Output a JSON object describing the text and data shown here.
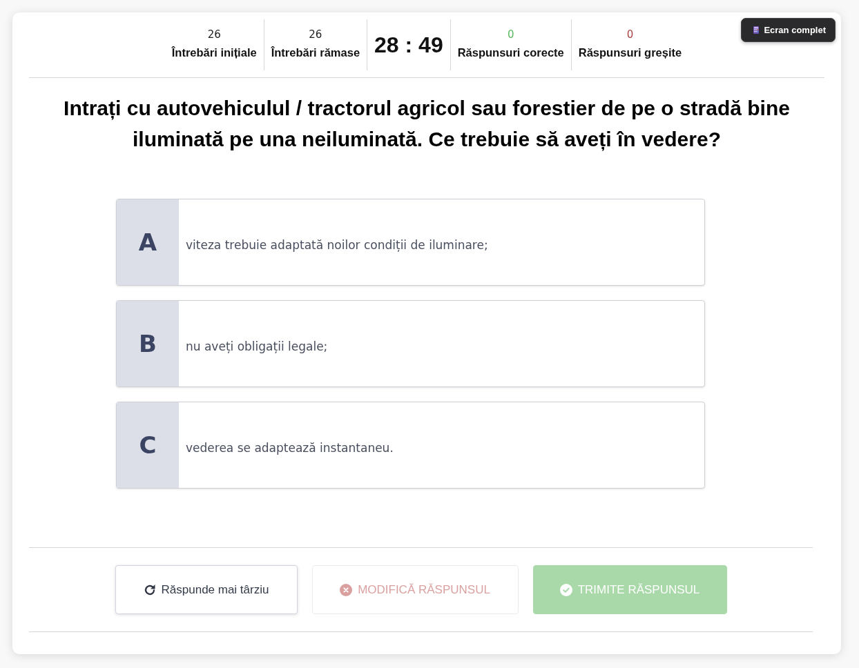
{
  "fullscreen_button": {
    "label": "Ecran complet"
  },
  "stats": [
    {
      "kind": "count",
      "value": "26",
      "label": "Întrebări inițiale",
      "color": "#222222"
    },
    {
      "kind": "count",
      "value": "26",
      "label": "Întrebări rămase",
      "color": "#222222"
    },
    {
      "kind": "timer",
      "value": "28 : 49"
    },
    {
      "kind": "count",
      "value": "0",
      "label": "Răspunsuri corecte",
      "color": "#5cb85c"
    },
    {
      "kind": "count",
      "value": "0",
      "label": "Răspunsuri greșite",
      "color": "#a94442"
    }
  ],
  "question": "Intrați cu autovehiculul / tractorul agricol sau forestier de pe o stradă bine iluminată pe una neiluminată. Ce trebuie să aveți în vedere?",
  "answers": [
    {
      "letter": "A",
      "text": "viteza trebuie adaptată noilor condiții de iluminare;",
      "selected": false
    },
    {
      "letter": "B",
      "text": "nu aveți obligații legale;",
      "selected": false
    },
    {
      "letter": "C",
      "text": "vederea se adaptează instantaneu.",
      "selected": false
    }
  ],
  "buttons": [
    {
      "kind": "later",
      "label": "Răspunde mai târziu",
      "disabled": false
    },
    {
      "kind": "modify",
      "label": "MODIFICĂ RĂSPUNSUL",
      "disabled": true
    },
    {
      "kind": "submit",
      "label": "TRIMITE RĂSPUNSUL",
      "disabled": true
    }
  ]
}
